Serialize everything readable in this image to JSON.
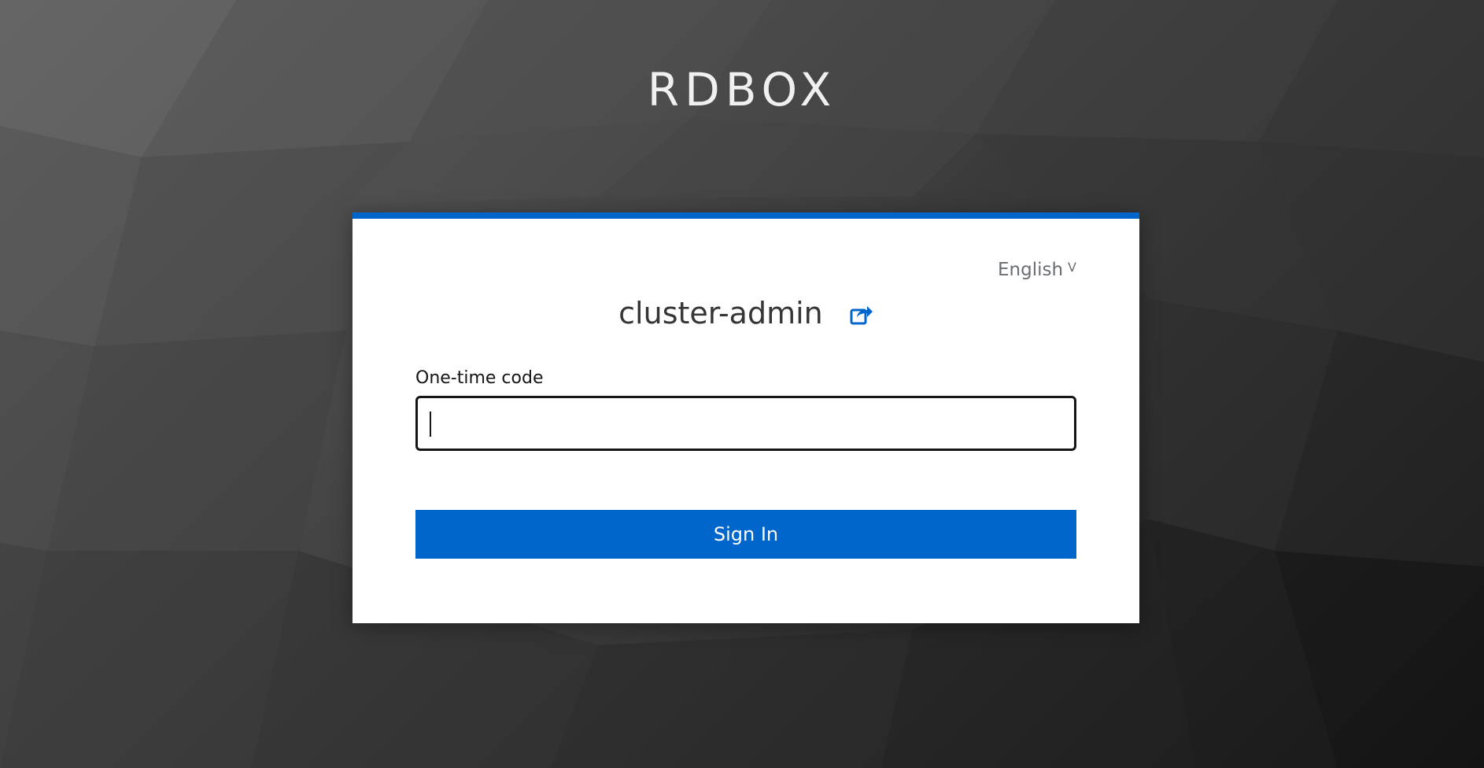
{
  "realm": {
    "title": "RDBOX"
  },
  "login": {
    "language": "English",
    "username": "cluster-admin",
    "otp_label": "One-time code",
    "otp_value": "",
    "submit_label": "Sign In"
  },
  "colors": {
    "accent": "#0066cc",
    "card_bg": "#ffffff",
    "text_dark": "#363636",
    "text_muted": "#6a6e73"
  },
  "icons": {
    "reset_login": "share-arrow-icon",
    "language_dropdown": "chevron-down-icon"
  }
}
